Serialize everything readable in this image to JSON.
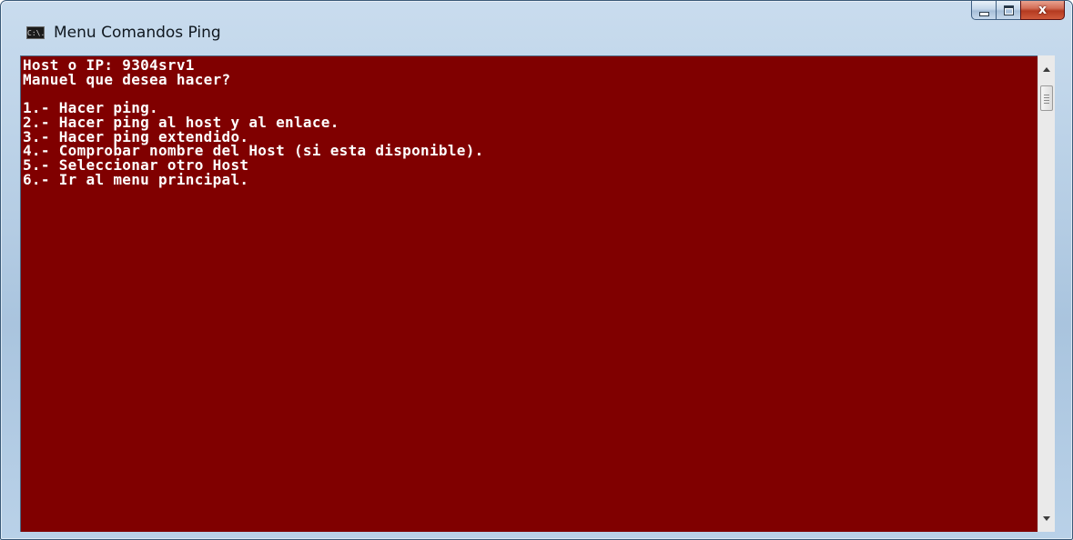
{
  "window": {
    "title": "Menu Comandos Ping",
    "icon": "C:\\.",
    "icon_name": "console-icon"
  },
  "caption_buttons": {
    "minimize": "minimize-icon",
    "maximize": "maximize-icon",
    "close": "close-icon",
    "close_glyph": "x"
  },
  "console": {
    "background_color": "#800000",
    "text_color": "#ffffff",
    "lines": [
      "Host o IP: 9304srv1",
      "Manuel que desea hacer?",
      "",
      "1.- Hacer ping.",
      "2.- Hacer ping al host y al enlace.",
      "3.- Hacer ping extendido.",
      "4.- Comprobar nombre del Host (si esta disponible).",
      "5.- Seleccionar otro Host",
      "6.- Ir al menu principal."
    ]
  },
  "scrollbar": {
    "up_icon": "scroll-up-arrow-icon",
    "down_icon": "scroll-down-arrow-icon"
  }
}
